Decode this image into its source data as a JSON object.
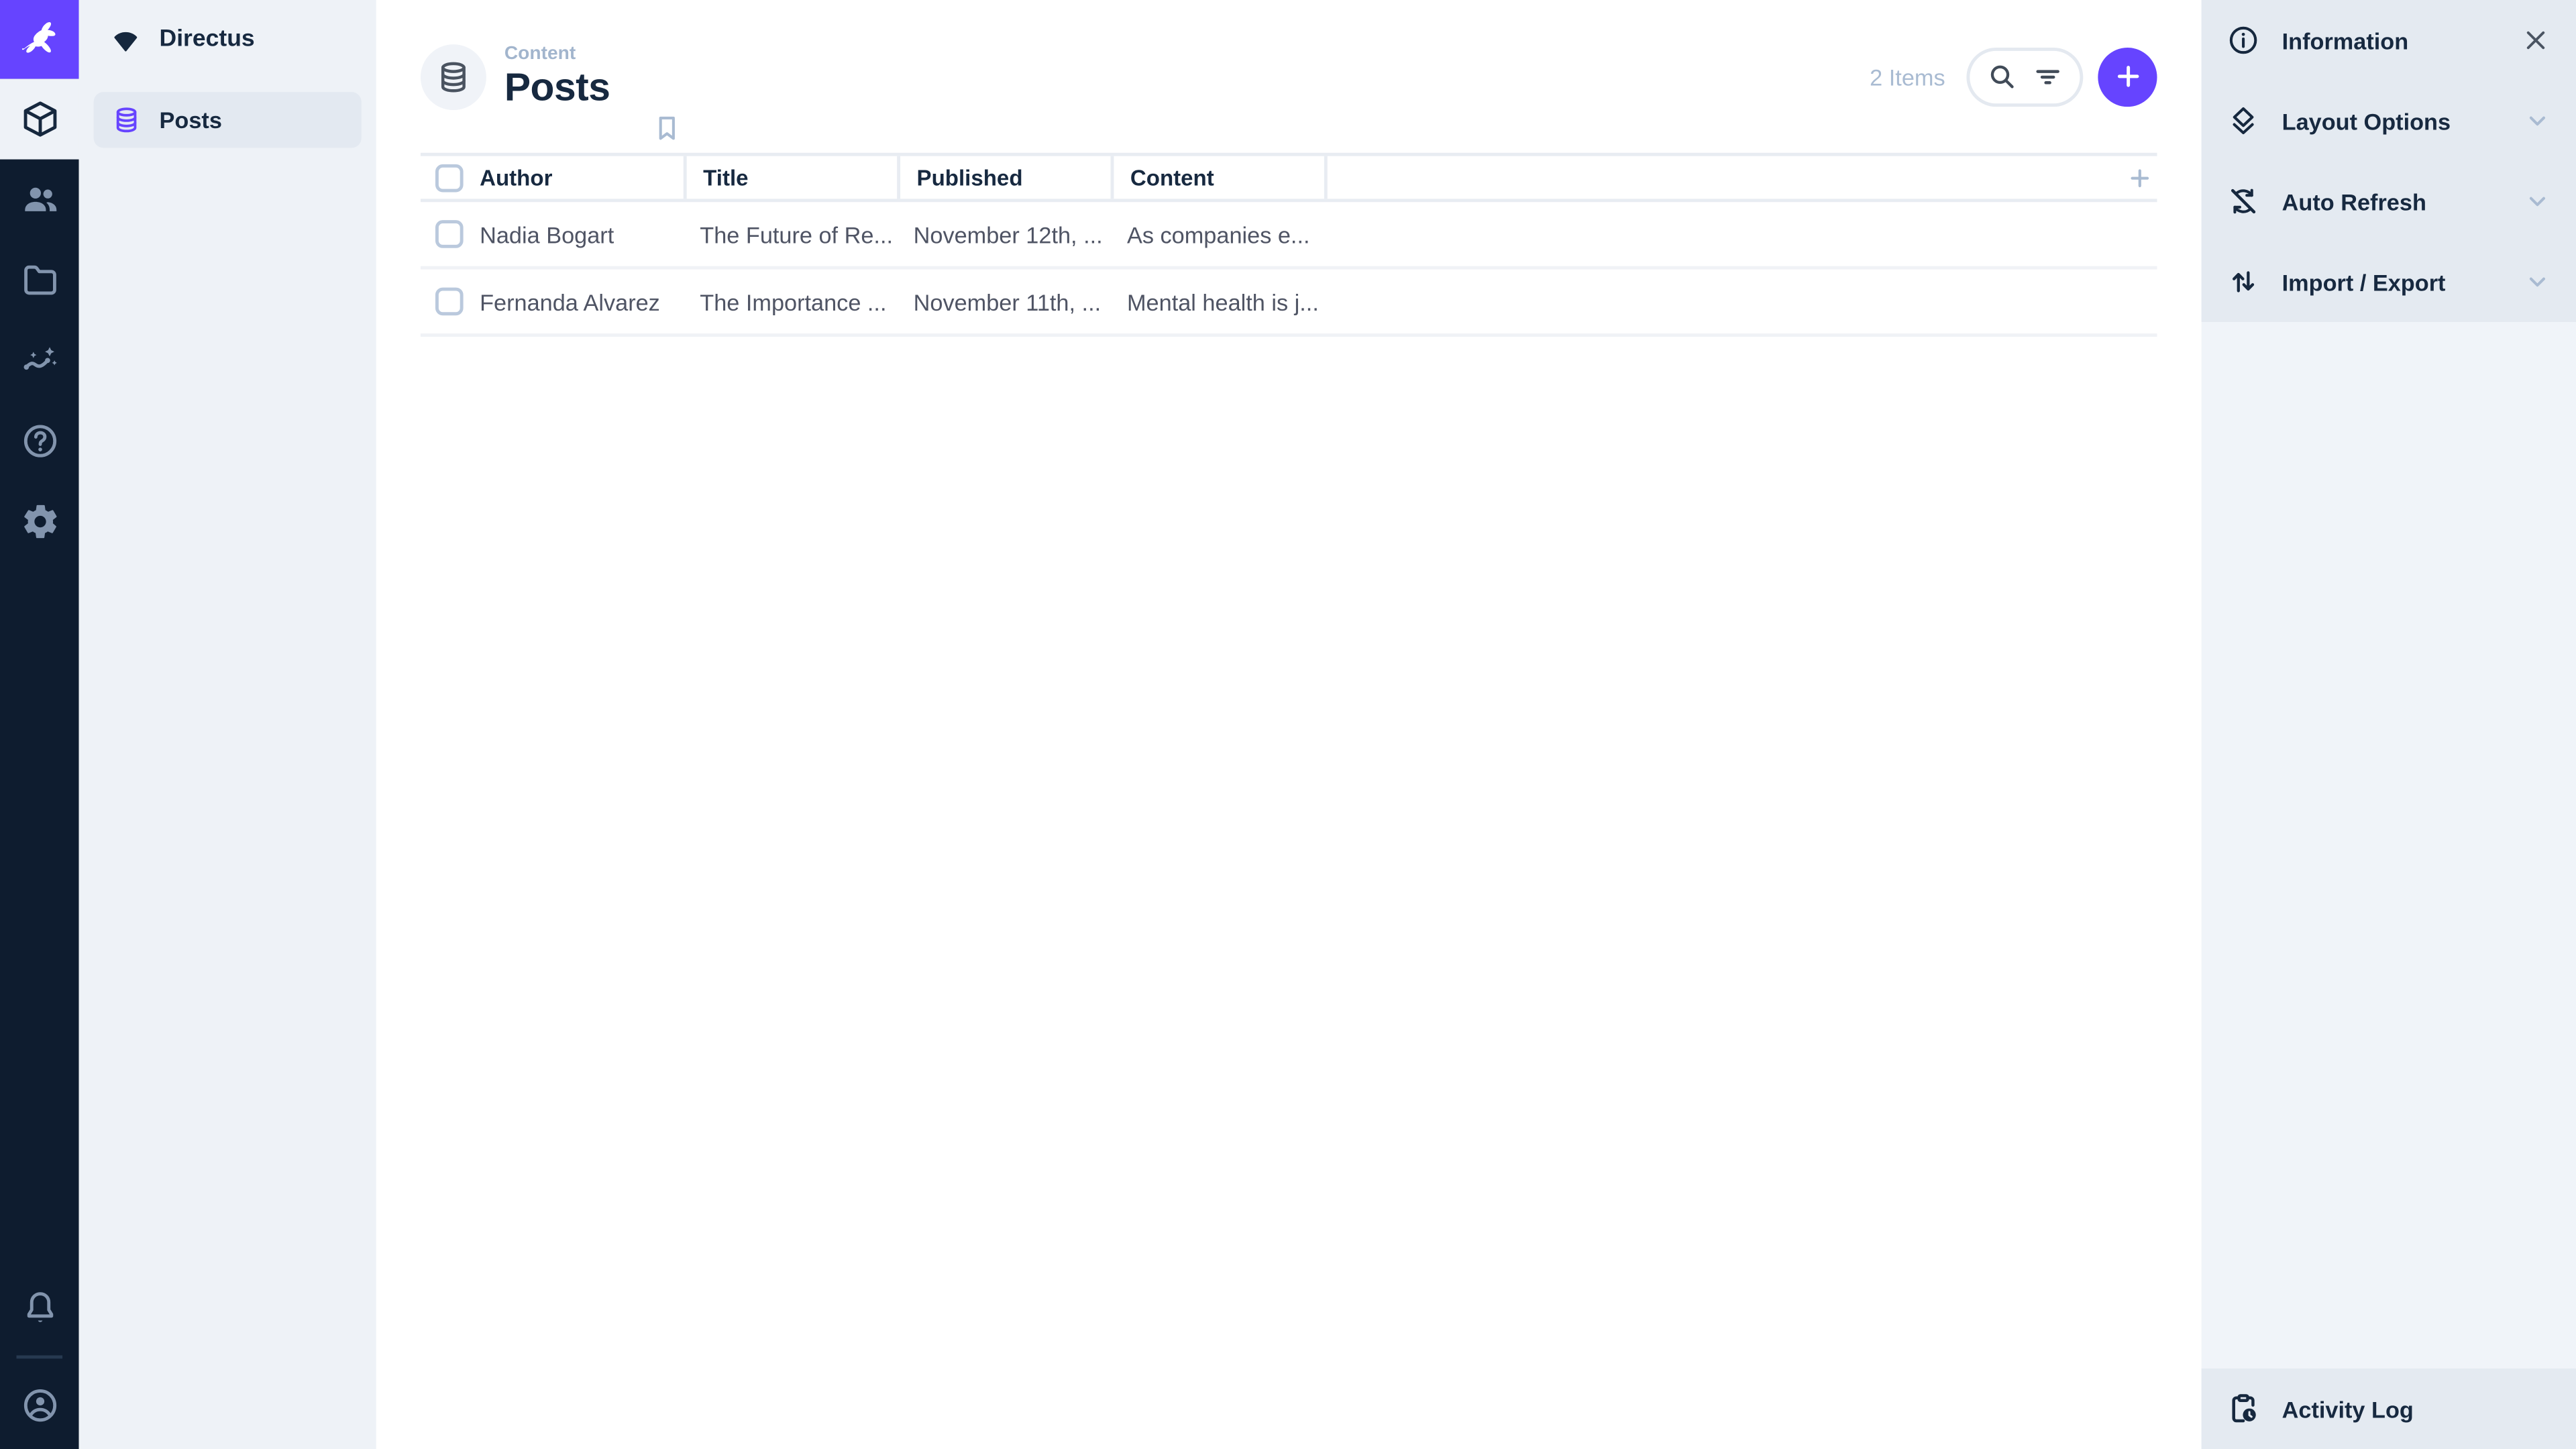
{
  "app": {
    "name": "Directus"
  },
  "colors": {
    "accent": "#6644ff",
    "module_bar_bg": "#0e1c2f",
    "nav_bg": "#eef2f7",
    "sidebar_section_bg": "#e4eaf1",
    "heading_text": "#172940",
    "body_text": "#4f5464",
    "subdued_text": "#a2b5cd"
  },
  "module_bar": {
    "logo_icon": "directus-rabbit-icon",
    "modules": [
      {
        "icon": "content-module-box-icon",
        "active": true
      },
      {
        "icon": "users-module-icon",
        "active": false
      },
      {
        "icon": "files-module-folder-icon",
        "active": false
      },
      {
        "icon": "insights-module-icon",
        "active": false
      },
      {
        "icon": "docs-module-help-icon",
        "active": false
      },
      {
        "icon": "settings-module-gear-icon",
        "active": false
      }
    ],
    "bottom": [
      {
        "icon": "notifications-bell-icon"
      },
      {
        "icon": "account-circle-icon"
      }
    ]
  },
  "nav": {
    "project_name": "Directus",
    "project_icon": "project-wedge-icon",
    "items": [
      {
        "label": "Posts",
        "icon": "database-icon",
        "active": true
      }
    ]
  },
  "header": {
    "breadcrumb": "Content",
    "title": "Posts",
    "items_count": "2 Items"
  },
  "table": {
    "columns": [
      "Author",
      "Title",
      "Published",
      "Content"
    ],
    "rows": [
      {
        "author": "Nadia Bogart",
        "title": "The Future of Re...",
        "published": "November 12th, ...",
        "content": "As companies e..."
      },
      {
        "author": "Fernanda Alvarez",
        "title": "The Importance ...",
        "published": "November 11th, ...",
        "content": "Mental health is j..."
      }
    ]
  },
  "sidebar": {
    "sections": [
      {
        "label": "Information",
        "icon": "info-icon",
        "action": "close-icon"
      },
      {
        "label": "Layout Options",
        "icon": "layers-icon",
        "action": "chevron-down-icon"
      },
      {
        "label": "Auto Refresh",
        "icon": "sync-disabled-icon",
        "action": "chevron-down-icon"
      },
      {
        "label": "Import / Export",
        "icon": "import-export-icon",
        "action": "chevron-down-icon"
      }
    ],
    "footer": {
      "label": "Activity Log",
      "icon": "activity-log-icon"
    }
  }
}
